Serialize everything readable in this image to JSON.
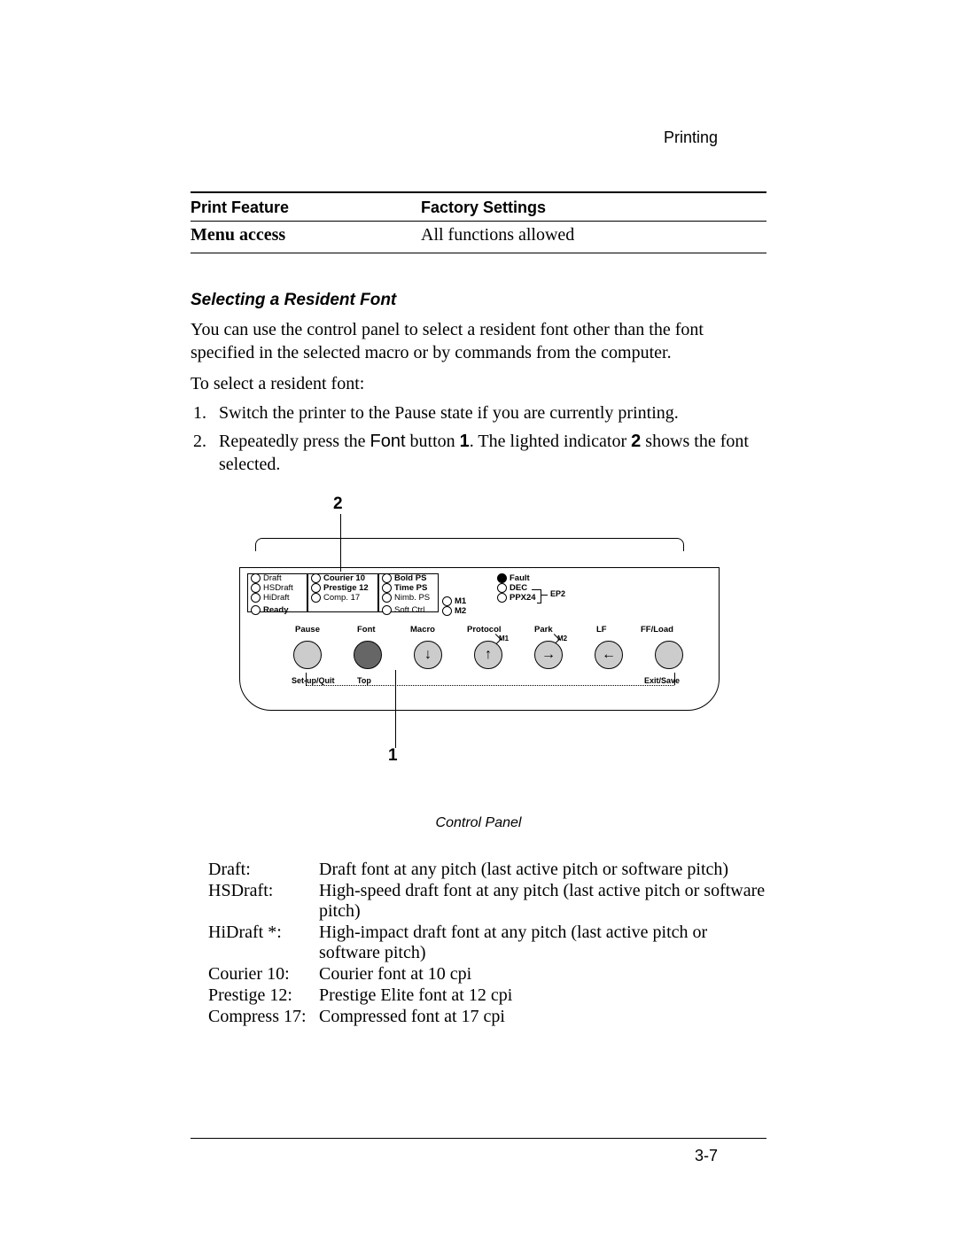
{
  "header": {
    "section": "Printing"
  },
  "table": {
    "col1_header": "Print Feature",
    "col2_header": "Factory Settings",
    "row1_c1": "Menu access",
    "row1_c2": "All functions allowed"
  },
  "section_heading": "Selecting a Resident Font",
  "intro": "You can use the control panel to select a resident font other than the font specified in the selected macro or by commands from the computer.",
  "lead_in": "To select a resident font:",
  "steps": {
    "s1_num": "1.",
    "s1_text": "Switch the printer to the Pause state if you are currently printing.",
    "s2_num": "2.",
    "s2_pre": "Repeatedly press the ",
    "s2_font_word": "Font",
    "s2_mid": " button ",
    "s2_call1": "1",
    "s2_mid2": ".  The lighted indicator ",
    "s2_call2": "2",
    "s2_post": " shows the font selected."
  },
  "diagram": {
    "callout2": "2",
    "callout1": "1",
    "col1": [
      "Draft",
      "HSDraft",
      "HiDraft",
      "Ready"
    ],
    "col2": [
      "Courier 10",
      "Prestige 12",
      "Comp. 17"
    ],
    "col3": [
      "Bold PS",
      "Time PS",
      "Nimb. PS",
      "Soft Ctrl."
    ],
    "col4": [
      "M1",
      "M2"
    ],
    "col5": [
      "Fault",
      "DEC",
      "PPX24"
    ],
    "ep2": "EP2",
    "btn_labels": [
      "Pause",
      "Font",
      "Macro",
      "Protocol",
      "Park",
      "LF",
      "FF/Load"
    ],
    "m_labels": [
      "M1",
      "M2"
    ],
    "under_left": "Set-up/Quit",
    "under_top": "Top",
    "under_right": "Exit/Save"
  },
  "figure_caption": "Control Panel",
  "definitions": [
    {
      "term": "Draft:",
      "def": "Draft font at any pitch (last active pitch or software pitch)"
    },
    {
      "term": "HSDraft:",
      "def": "High-speed draft font at any pitch (last active pitch or software pitch)"
    },
    {
      "term": "HiDraft *:",
      "def": "High-impact draft font at any pitch (last active pitch or software pitch)"
    },
    {
      "term": "Courier 10:",
      "def": "Courier font at 10 cpi"
    },
    {
      "term": "Prestige 12:",
      "def": "Prestige Elite font at 12 cpi"
    },
    {
      "term": "Compress 17:",
      "def": "Compressed font at 17 cpi"
    }
  ],
  "page_number": "3-7"
}
